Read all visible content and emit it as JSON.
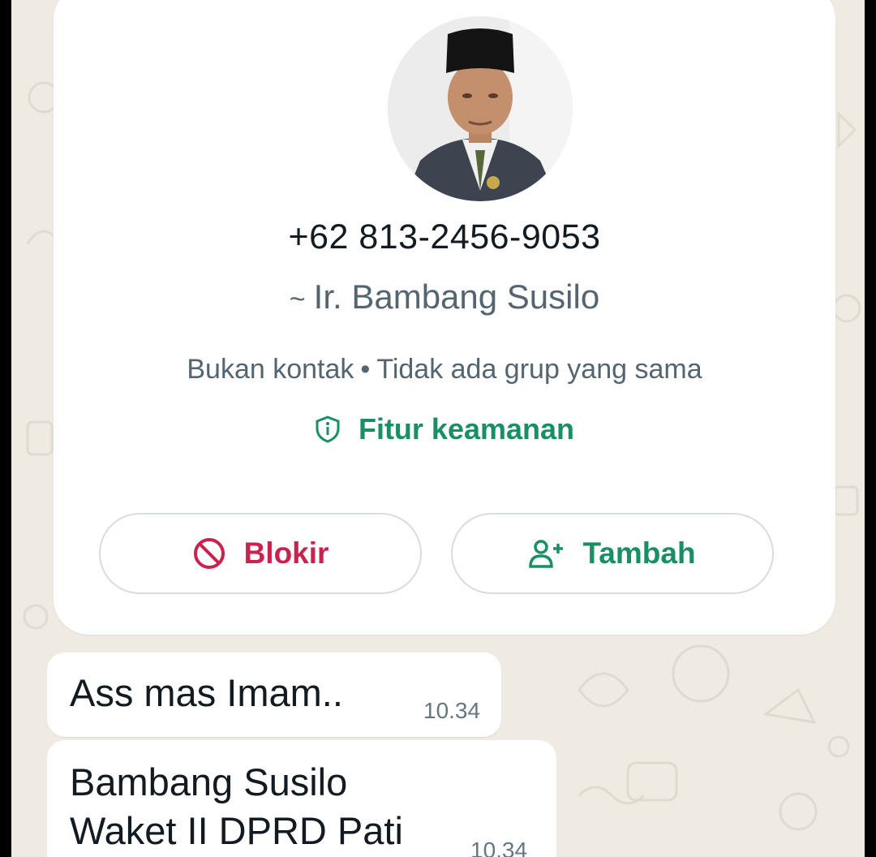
{
  "contact_card": {
    "phone_number": "+62 813-2456-9053",
    "push_name_prefix": "~",
    "push_name": "Ir. Bambang Susilo",
    "not_contact": "Bukan kontak",
    "separator": "•",
    "no_common_groups": "Tidak ada grup yang sama",
    "security_link": "Fitur keamanan",
    "block_label": "Blokir",
    "add_label": "Tambah"
  },
  "messages": [
    {
      "text": "Ass mas Imam..",
      "time": "10.34"
    },
    {
      "lines": [
        "Bambang Susilo",
        "Waket II DPRD Pati"
      ],
      "time": "10.34"
    }
  ],
  "icons": {
    "security": "shield-icon",
    "block": "block-icon",
    "add": "add-contact-icon"
  },
  "colors": {
    "green_accent": "#1a8f63",
    "block_red": "#c8224f",
    "chat_background": "#efeae2"
  }
}
